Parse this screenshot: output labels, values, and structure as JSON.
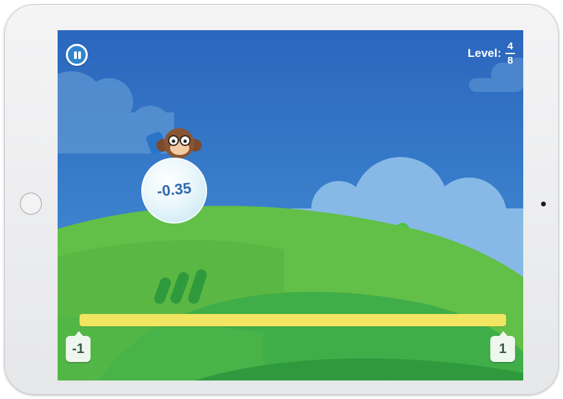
{
  "game": {
    "level_label": "Level:",
    "level_numerator": "4",
    "level_denominator": "8",
    "bubble_value": "-0.35",
    "number_line": {
      "min_label": "-1",
      "max_label": "1"
    }
  },
  "icons": {
    "pause": "pause-icon"
  },
  "colors": {
    "sky": "#2d72c4",
    "hill_front": "#3fae48",
    "number_line": "#f2e561",
    "pause_button": "#2f86cf"
  }
}
